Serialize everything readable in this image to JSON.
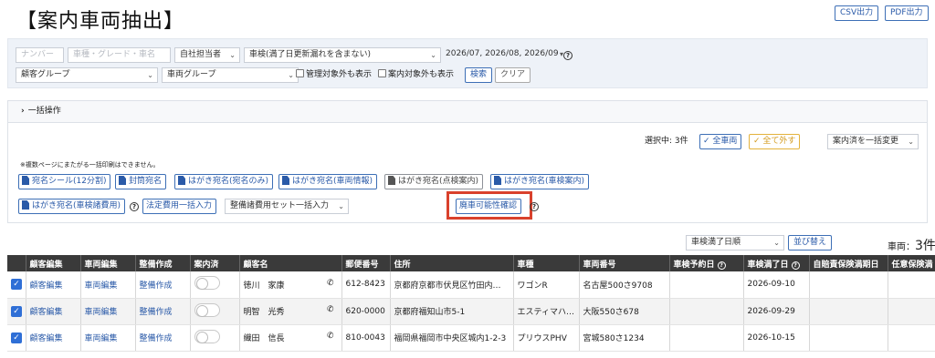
{
  "page": {
    "title": "【案内車両抽出】"
  },
  "header_buttons": {
    "csv": "CSV出力",
    "pdf": "PDF出力"
  },
  "filters": {
    "number_placeholder": "ナンバー",
    "vehicle_placeholder": "車種・グレード・車名",
    "owner_select": "自社担当者",
    "inspection_select": "車検(満了日更新漏れを含まない)",
    "months_select": "2026/07, 2026/08, 2026/09",
    "customer_group": "顧客グループ",
    "vehicle_group": "車両グループ",
    "exclude_managed": "管理対象外も表示",
    "exclude_guide": "案内対象外も表示",
    "search": "検索",
    "clear": "クリア"
  },
  "bulk": {
    "header": "一括操作",
    "selected_label": "選択中: 3件",
    "select_all": "全車両",
    "deselect_all": "全て外す",
    "bulk_change": "案内済を一括変更",
    "note": "※複数ページにまたがる一括印刷はできません。",
    "print_buttons": [
      {
        "label": "宛名シール(12分割)",
        "color": "blue"
      },
      {
        "label": "封筒宛名",
        "color": "blue"
      },
      {
        "label": "はがき宛名(宛名のみ)",
        "color": "blue"
      },
      {
        "label": "はがき宛名(車両情報)",
        "color": "blue"
      },
      {
        "label": "はがき宛名(点検案内)",
        "color": "gray"
      },
      {
        "label": "はがき宛名(車検案内)",
        "color": "blue"
      }
    ],
    "print_inspection_cost": "はがき宛名(車検諸費用)",
    "legal_cost": "法定費用一括入力",
    "maintenance_set": "整備諸費用セット一括入力",
    "scrap_check": "廃車可能性確認"
  },
  "sort": {
    "select": "車検満了日順",
    "button": "並び替え",
    "count_label": "車両：",
    "count_value": "3件"
  },
  "table": {
    "headers": [
      "",
      "顧客編集",
      "車両編集",
      "整備作成",
      "案内済",
      "顧客名",
      "郵便番号",
      "住所",
      "車種",
      "車両番号",
      "車検予約日",
      "車検満了日",
      "自賠責保険満期日",
      "任意保険満"
    ],
    "rows": [
      {
        "customer_edit": "顧客編集",
        "vehicle_edit": "車両編集",
        "maint": "整備作成",
        "name": "徳川　家康",
        "zip": "612-8423",
        "address": "京都府京都市伏見区竹田内…",
        "model": "ワゴンR",
        "plate": "名古屋500さ9708",
        "reserve": "",
        "expiry": "2026-09-10"
      },
      {
        "customer_edit": "顧客編集",
        "vehicle_edit": "車両編集",
        "maint": "整備作成",
        "name": "明智　光秀",
        "zip": "620-0000",
        "address": "京都府福知山市5-1",
        "model": "エスティマハ…",
        "plate": "大阪550さ678",
        "reserve": "",
        "expiry": "2026-09-29"
      },
      {
        "customer_edit": "顧客編集",
        "vehicle_edit": "車両編集",
        "maint": "整備作成",
        "name": "織田　信長",
        "zip": "810-0043",
        "address": "福岡県福岡市中央区城内1-2-3",
        "model": "プリウスPHV",
        "plate": "宮城580さ1234",
        "reserve": "",
        "expiry": "2026-10-15"
      }
    ]
  }
}
